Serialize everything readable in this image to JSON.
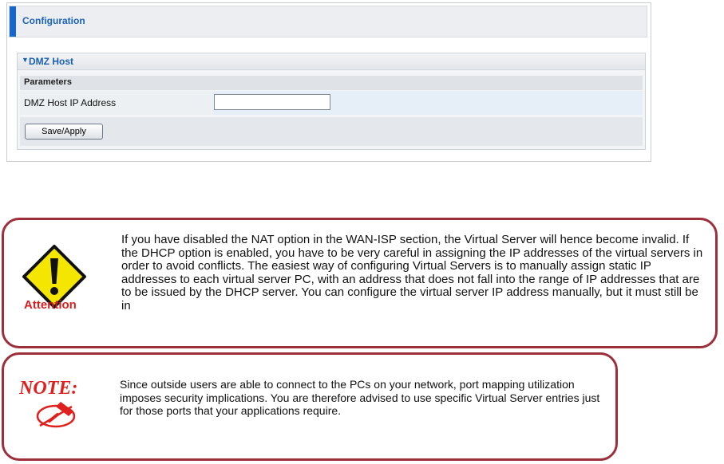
{
  "config": {
    "header_title": "Configuration",
    "section_title": "DMZ Host",
    "parameters_label": "Parameters",
    "dmz_ip_label": "DMZ Host IP Address",
    "dmz_ip_value": "",
    "save_button": "Save/Apply"
  },
  "attention": {
    "label": "Attention",
    "text": "If you have disabled the NAT option in the WAN-ISP section, the Virtual Server will hence become invalid. If the DHCP option is enabled, you have to be very careful in assigning the IP addresses of the virtual servers in order to avoid conflicts. The easiest way of configuring Virtual Servers is to manually assign static IP addresses to each virtual server PC, with an address that does not fall into the range of IP addresses that are to be issued by the DHCP server. You can configure the virtual server IP address manually, but it must still be in"
  },
  "note": {
    "logo_text": "NOTE:",
    "text": "Since outside users are able to connect to the PCs on your network, port mapping utilization imposes security implications. You are therefore advised to use specific Virtual Server entries just for those ports that your applications require."
  },
  "colors": {
    "accent": "#1766c9",
    "callout_border": "#9c2f3a",
    "attention_red": "#d41f1f",
    "warning_yellow": "#f5e600"
  }
}
